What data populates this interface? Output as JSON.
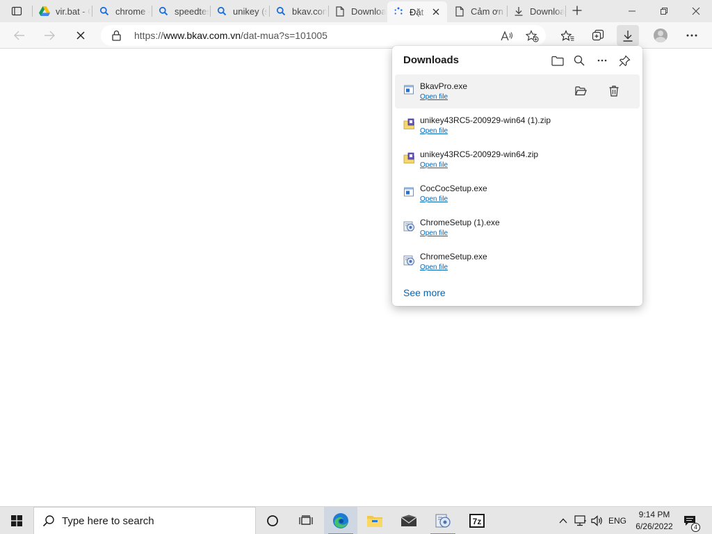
{
  "tabs": [
    {
      "favicon": "google-drive-icon",
      "title": "vir.bat - Go"
    },
    {
      "favicon": "search-icon",
      "title": "chrome - Tìm"
    },
    {
      "favicon": "search-icon",
      "title": "speedtest"
    },
    {
      "favicon": "search-icon",
      "title": "unikey (s"
    },
    {
      "favicon": "search-icon",
      "title": "bkav.com"
    },
    {
      "favicon": "page-icon",
      "title": "Download"
    },
    {
      "favicon": "loading-icon",
      "title": "Đặt",
      "active": true
    },
    {
      "favicon": "page-icon",
      "title": "Cảm ơn b"
    },
    {
      "favicon": "download-icon",
      "title": "Downloa"
    }
  ],
  "address_bar": {
    "url_prefix": "https://",
    "url_host": "www.bkav.com.vn",
    "url_path": "/dat-mua?s=101005"
  },
  "downloads": {
    "title": "Downloads",
    "open_file_label": "Open file",
    "see_more_label": "See more",
    "items": [
      {
        "name": "BkavPro.exe",
        "icon": "exe-window-icon",
        "hovered": true
      },
      {
        "name": "unikey43RC5-200929-win64 (1).zip",
        "icon": "zip-folder-icon"
      },
      {
        "name": "unikey43RC5-200929-win64.zip",
        "icon": "zip-folder-icon"
      },
      {
        "name": "CocCocSetup.exe",
        "icon": "exe-window-icon"
      },
      {
        "name": "ChromeSetup (1).exe",
        "icon": "installer-icon"
      },
      {
        "name": "ChromeSetup.exe",
        "icon": "installer-icon"
      }
    ]
  },
  "taskbar": {
    "search_placeholder": "Type here to search",
    "language": "ENG",
    "time": "9:14 PM",
    "date": "6/26/2022",
    "notification_count": "4"
  },
  "colors": {
    "link": "#0067b8",
    "edge_blue": "#1d7bd4",
    "edge_green": "#45c26b",
    "tab_strip": "#e9e9e9",
    "toolbar": "#f7f7f7"
  }
}
